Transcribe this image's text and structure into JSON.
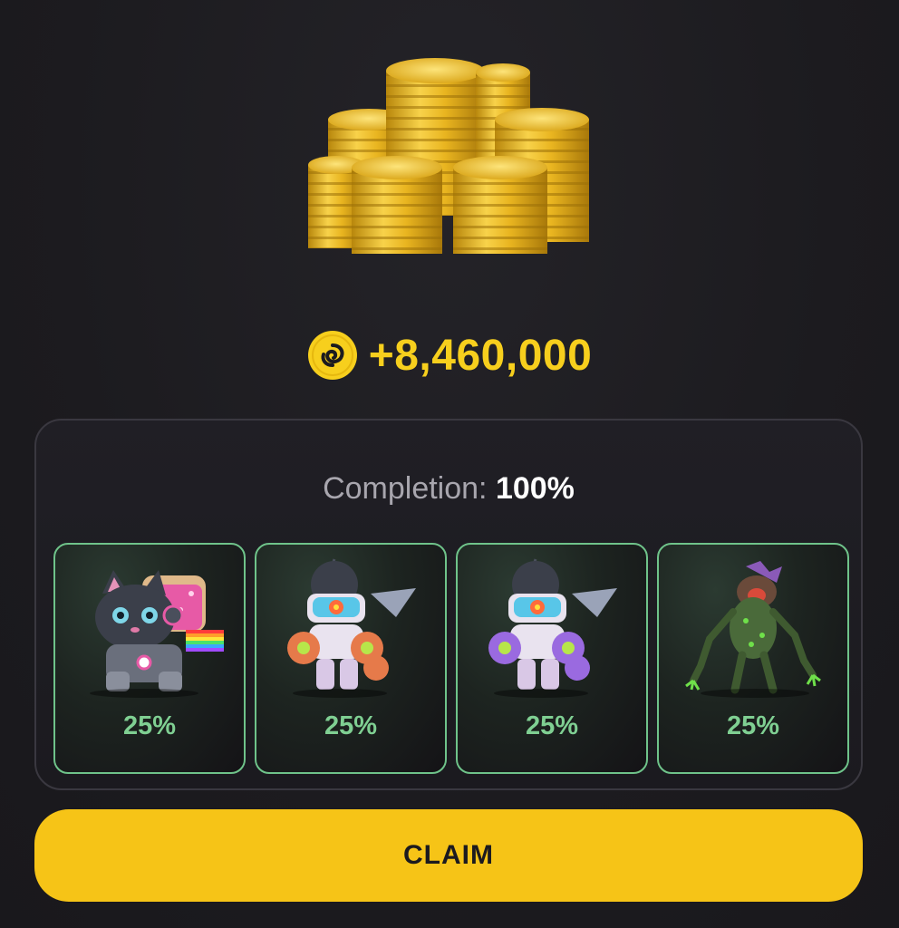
{
  "reward": {
    "amount": "+8,460,000",
    "currency_icon": "spiral-coin-icon",
    "illustration": "gold-coin-stacks-icon"
  },
  "completion": {
    "label": "Completion:",
    "value": "100%"
  },
  "cards": [
    {
      "character": "cat-robot-icon",
      "percent": "25%"
    },
    {
      "character": "orange-astronaut-robot-icon",
      "percent": "25%"
    },
    {
      "character": "purple-astronaut-robot-icon",
      "percent": "25%"
    },
    {
      "character": "green-mutant-creature-icon",
      "percent": "25%"
    }
  ],
  "claim_button": {
    "label": "CLAIM"
  },
  "colors": {
    "background": "#1c1b1f",
    "accent_yellow": "#f6c417",
    "card_border_green": "#6fc38a",
    "percent_green": "#7fcf92"
  }
}
